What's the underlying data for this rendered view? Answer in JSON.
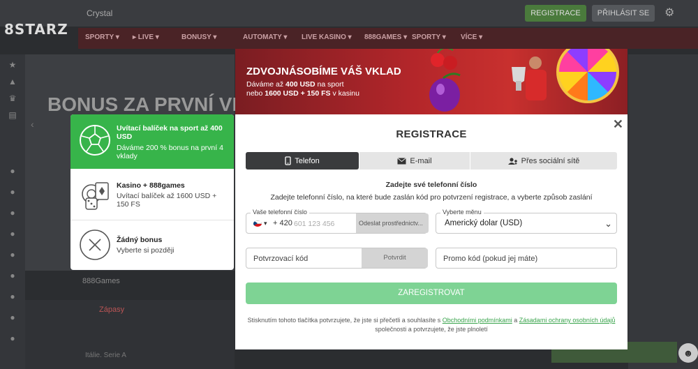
{
  "header": {
    "logo": "8STARZ",
    "crystal_label": "Crystal",
    "register_label": "REGISTRACE",
    "login_label": "PŘIHLÁSIT SE"
  },
  "nav": {
    "items": [
      "SPORTY ▾",
      "▸ LIVE ▾",
      "BONUSY ▾",
      "AUTOMATY ▾",
      "LIVE KASINO ▾",
      "888GAMES ▾",
      "SPORTY ▾",
      "VÍCE ▾"
    ]
  },
  "background": {
    "hero_title": "BONUS ZA PRVNÍ VKL",
    "tab_zapasy": "Zápasy",
    "games_label": "888Games",
    "match_label": "Itálie. Serie A"
  },
  "banner": {
    "title": "ZDVOJNÁSOBÍME VÁŠ VKLAD",
    "line1_pre": "Dáváme až ",
    "line1_bold": "400 USD",
    "line1_post": " na sport",
    "line2_pre": "nebo ",
    "line2_bold": "1600 USD + 150 FS",
    "line2_post": " v kasinu"
  },
  "bonus_options": [
    {
      "title": "Uvítací balíček na sport až 400 USD",
      "desc": "Dáváme 200 % bonus na první 4 vklady",
      "icon": "soccer-ball-icon",
      "active": true
    },
    {
      "title": "Kasino + 888games",
      "desc": "Uvítací balíček až 1600 USD + 150 FS",
      "icon": "casino-chips-icon",
      "active": false
    },
    {
      "title": "Žádný bonus",
      "desc": "Vyberte si později",
      "icon": "no-bonus-icon",
      "active": false
    }
  ],
  "modal": {
    "title": "REGISTRACE",
    "close": "✕",
    "tabs": [
      {
        "label": "Telefon",
        "icon": "phone-icon"
      },
      {
        "label": "E-mail",
        "icon": "envelope-icon"
      },
      {
        "label": "Přes sociální sítě",
        "icon": "users-icon"
      }
    ],
    "instr_title": "Zadejte své telefonní číslo",
    "instr_text": "Zadejte telefonní číslo, na které bude zaslán kód pro potvrzení registrace, a vyberte způsob zaslání",
    "phone": {
      "label": "Vaše telefonní číslo",
      "prefix": "+ 420",
      "placeholder": "601 123 456",
      "send_label": "Odeslat prostřednictv..."
    },
    "currency": {
      "label": "Vyberte měnu",
      "value": "Americký dolar (USD)"
    },
    "confirm_code": {
      "placeholder": "Potvrzovací kód",
      "button": "Potvrdit"
    },
    "promo": {
      "placeholder": "Promo kód (pokud jej máte)"
    },
    "submit": "ZAREGISTROVAT",
    "legal": {
      "part1": "Stisknutím tohoto tlačítka potvrzujete, že jste si přečetli a souhlasíte s ",
      "link1": "Obchodními podmínkami",
      "part2": " a ",
      "link2": "Zásadami ochrany osobních údajů",
      "part3": " společnosti a potvrzujete, že jste plnoletí"
    }
  },
  "colors": {
    "accent_green": "#37b44a",
    "submit_disabled": "#7ed394",
    "active_tab": "#3a3b3d",
    "banner_red": "#b3262a"
  }
}
